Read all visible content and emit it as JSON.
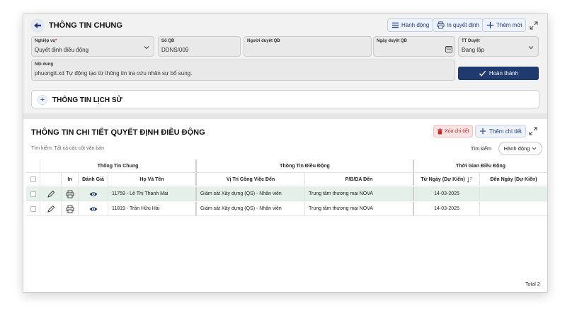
{
  "header": {
    "title": "THÔNG TIN CHUNG",
    "btn_action": "Hành động",
    "btn_print": "In quyết định",
    "btn_add": "Thêm mới"
  },
  "form": {
    "nghiep_vu_label": "Nghiệp vụ",
    "nghiep_vu_value": "Quyết định điều động",
    "so_qd_label": "Số QĐ",
    "so_qd_value": "DDNS/009",
    "nguoi_duyet_label": "Người duyệt QĐ",
    "nguoi_duyet_value": "",
    "ngay_duyet_label": "Ngày duyệt QĐ",
    "ngay_duyet_value": "",
    "tt_duyet_label": "TT Duyệt",
    "tt_duyet_value": "Đang lập",
    "noi_dung_label": "Nội dung",
    "noi_dung_value": "phuongtt.xd Tự động tạo từ thông tin tra cứu nhân sự bổ sung.",
    "done_button": "Hoàn thành"
  },
  "history": {
    "title": "THÔNG TIN LỊCH SỬ"
  },
  "detail": {
    "title": "THÔNG TIN CHI TIẾT QUYẾT ĐỊNH ĐIỀU ĐỘNG",
    "delete_button": "Xóa chi tiết",
    "add_button": "Thêm chi tiết",
    "search_label": "Tìm kiếm: Tất cả các cột văn bản",
    "search_button": "Tìm kiếm",
    "action_button": "Hành động"
  },
  "table": {
    "group_headers": [
      "Thông Tin Chung",
      "Thông Tin Điều Động",
      "Thời Gian Điều Động"
    ],
    "columns": [
      "In",
      "Đánh Giá",
      "Họ Và Tên",
      "Vị Trí Công Việc Đến",
      "P/B/DA Đến",
      "Từ Ngày (Dự Kiến)",
      "Đến Ngày (Dự Kiến)"
    ],
    "rows": [
      {
        "name": "11759 - Lê Thị Thanh Mai",
        "position": "Giám sát Xây dựng (QS) - Nhân viên",
        "dept": "Trung tâm thương mại NOVA",
        "from": "14-03-2025",
        "to": ""
      },
      {
        "name": "11819 - Trần Hữu Hải",
        "position": "Giám sát Xây dựng (QS) - Nhân viên",
        "dept": "Trung tâm thương mại NOVA",
        "from": "14-03-2025",
        "to": ""
      }
    ]
  },
  "footer": {
    "total": "Total 2"
  },
  "colors": {
    "primary": "#1e3a6e",
    "accent_bg": "#eef2fa",
    "danger": "#c62828",
    "selected_row": "#e6f0ea"
  },
  "icons": [
    "back-arrow-icon",
    "list-icon",
    "printer-icon",
    "plus-icon",
    "expand-icon",
    "chevron-down-icon",
    "calendar-icon",
    "check-icon",
    "trash-icon",
    "edit-icon",
    "eye-icon",
    "sort-icon"
  ]
}
